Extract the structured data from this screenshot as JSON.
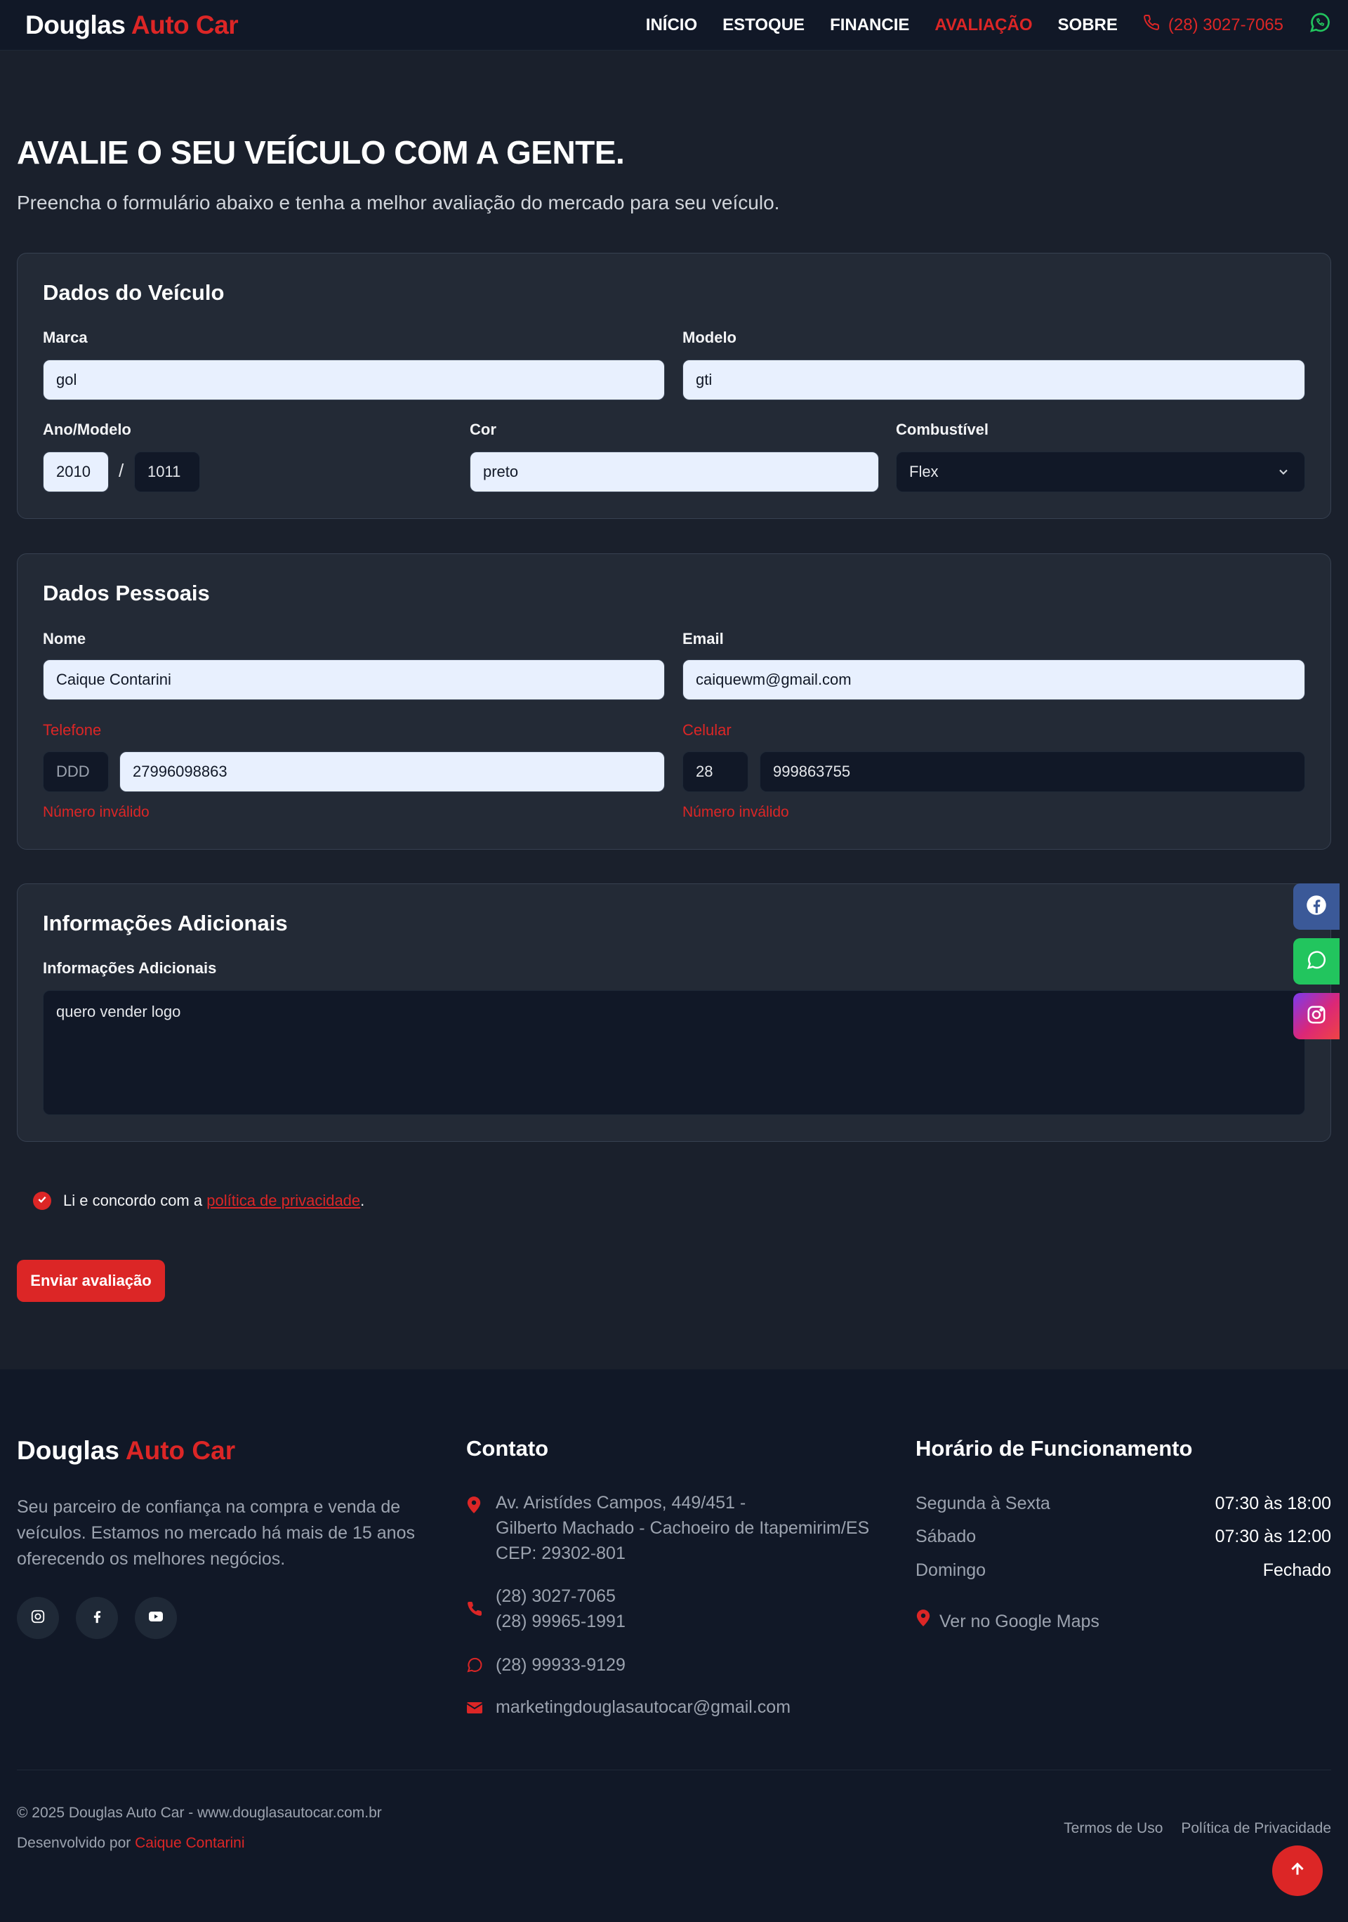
{
  "nav": {
    "brand_main": "Douglas",
    "brand_accent": "Auto Car",
    "items": [
      {
        "label": "INÍCIO"
      },
      {
        "label": "ESTOQUE"
      },
      {
        "label": "FINANCIE"
      },
      {
        "label": "AVALIAÇÃO",
        "active": true
      },
      {
        "label": "SOBRE"
      }
    ],
    "phone": "(28) 3027-7065",
    "phone_icon": "phone-icon",
    "whatsapp_icon": "whatsapp-icon"
  },
  "header": {
    "title": "AVALIE O SEU VEÍCULO COM A GENTE.",
    "subtitle": "Preencha o formulário abaixo e tenha a melhor avaliação do mercado para seu veículo."
  },
  "vehicle": {
    "title": "Dados do Veículo",
    "marca_label": "Marca",
    "marca_value": "gol",
    "modelo_label": "Modelo",
    "modelo_value": "gti",
    "ano_label": "Ano/Modelo",
    "ano_value": "2010",
    "ano_sep": "/",
    "modelo_ano_value": "1011",
    "cor_label": "Cor",
    "cor_value": "preto",
    "combustivel_label": "Combustível",
    "combustivel_value": "Flex"
  },
  "personal": {
    "title": "Dados Pessoais",
    "nome_label": "Nome",
    "nome_value": "Caique Contarini",
    "email_label": "Email",
    "email_value": "caiquewm@gmail.com",
    "telefone_label": "Telefone",
    "telefone_ddd_placeholder": "DDD",
    "telefone_value": "27996098863",
    "telefone_error": "Número inválido",
    "celular_label": "Celular",
    "celular_ddd_value": "28",
    "celular_value": "999863755",
    "celular_error": "Número inválido"
  },
  "additional": {
    "title": "Informações Adicionais",
    "label": "Informações Adicionais",
    "value": "quero vender logo"
  },
  "consent": {
    "text": "Li e concordo com a ",
    "link": "política de privacidade",
    "end": ".",
    "checked": true
  },
  "submit": {
    "label": "Enviar avaliação"
  },
  "side_social": [
    {
      "icon": "facebook-icon",
      "color": "#3b5998"
    },
    {
      "icon": "whatsapp-icon",
      "color": "#22c55e"
    },
    {
      "icon": "instagram-icon",
      "color": "#c13584"
    }
  ],
  "footer": {
    "brand_main": "Douglas",
    "brand_accent": "Auto Car",
    "description": "Seu parceiro de confiança na compra e venda de veículos. Estamos no mercado há mais de 15 anos oferecendo os melhores negócios.",
    "social_icons": [
      "instagram-icon",
      "facebook-icon",
      "youtube-icon"
    ],
    "contact_title": "Contato",
    "address_line1": "Av. Aristídes Campos, 449/451 -",
    "address_line2": "Gilberto Machado - Cachoeiro de Itapemirim/ES",
    "address_line3": "CEP: 29302-801",
    "phone1": "(28) 3027-7065",
    "phone2": "(28) 99965-1991",
    "whatsapp": "(28) 99933-9129",
    "email": "marketingdouglasautocar@gmail.com",
    "hours_title": "Horário de Funcionamento",
    "hours": [
      {
        "day": "Segunda à Sexta",
        "time": "07:30 às 18:00"
      },
      {
        "day": "Sábado",
        "time": "07:30 às 12:00"
      },
      {
        "day": "Domingo",
        "time": "Fechado"
      }
    ],
    "maps_link": "Ver no Google Maps",
    "copyright": "© 2025 Douglas Auto Car - www.douglasautocar.com.br",
    "dev_prefix": "Desenvolvido por ",
    "dev_name": "Caique Contarini",
    "links": [
      "Termos de Uso",
      "Política de Privacidade"
    ]
  },
  "colors": {
    "accent": "#dc2626",
    "background": "#1a202c",
    "card": "#232a36",
    "footer": "#111827",
    "input_filled": "#e8f0fe"
  }
}
